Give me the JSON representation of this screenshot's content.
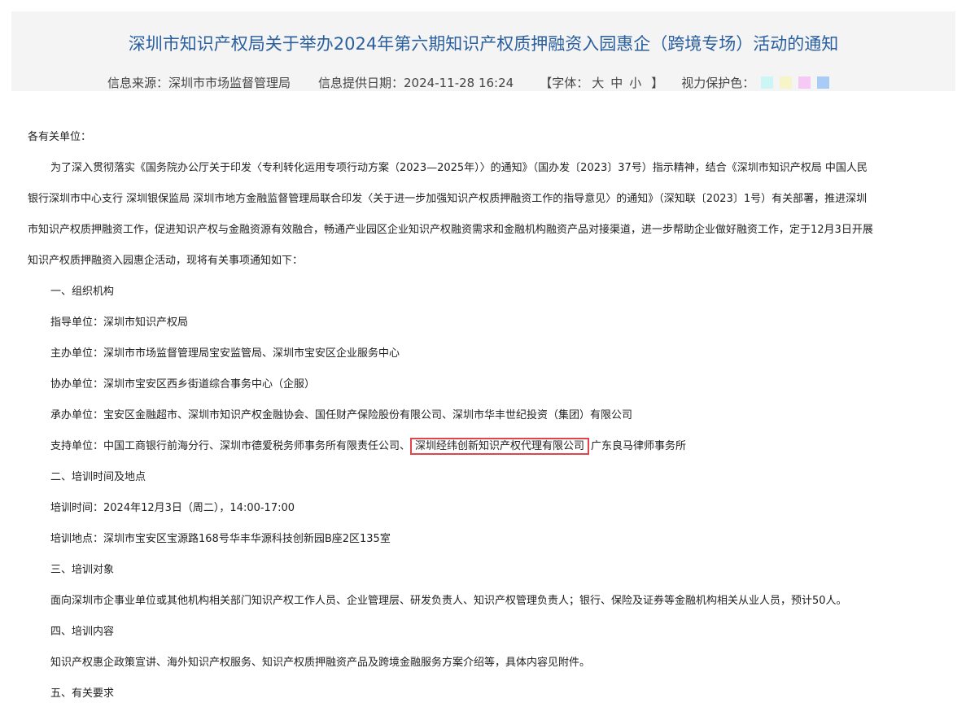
{
  "header": {
    "title": "深圳市知识产权局关于举办2024年第六期知识产权质押融资入园惠企（跨境专场）活动的通知",
    "source": "信息来源：深圳市市场监督管理局",
    "date": "信息提供日期：2024-11-28 16:24",
    "font_open": "【字体：",
    "font_large": "大",
    "font_medium": "中",
    "font_small": "小",
    "font_close": "】",
    "eye_label": "视力保护色：",
    "swatch_colors": [
      "#ccf5f5",
      "#f5f5c8",
      "#f5c8f5",
      "#a8ccf5"
    ]
  },
  "body": {
    "salutation": "各有关单位：",
    "intro_1": "为了深入贯彻落实《国务院办公厅关于印发〈专利转化运用专项行动方案（2023—2025年）〉的通知》（国办发〔2023〕37号）指示精神，结合《深圳市知识产权局 中国人民",
    "intro_2": "银行深圳市中心支行 深圳银保监局 深圳市地方金融监督管理局联合印发〈关于进一步加强知识产权质押融资工作的指导意见〉的通知》（深知联〔2023〕1号）有关部署，推进深圳",
    "intro_3": "市知识产权质押融资工作，促进知识产权与金融资源有效融合，畅通产业园区企业知识产权融资需求和金融机构融资产品对接渠道，进一步帮助企业做好融资工作，定于12月3日开展",
    "intro_4": "知识产权质押融资入园惠企活动，现将有关事项通知如下：",
    "sec1": "一、组织机构",
    "guide": "指导单位：深圳市知识产权局",
    "host": "主办单位：深圳市市场监督管理局宝安监管局、深圳市宝安区企业服务中心",
    "co": "协办单位：深圳市宝安区西乡街道综合事务中心（企服）",
    "organizer": "承办单位：宝安区金融超市、深圳市知识产权金融协会、国任财产保险股份有限公司、深圳市华丰世纪投资（集团）有限公司",
    "support_pre": "支持单位：中国工商银行前海分行、深圳市德爱税务师事务所有限责任公司、",
    "support_hl": "深圳经纬创新知识产权代理有限公司",
    "support_post": "广东良马律师事务所",
    "sec2": "二、培训时间及地点",
    "time": "培训时间：2024年12月3日（周二），14:00-17:00",
    "place": "培训地点：深圳市宝安区宝源路168号华丰华源科技创新园B座2区135室",
    "sec3": "三、培训对象",
    "target": "面向深圳市企事业单位或其他机构相关部门知识产权工作人员、企业管理层、研发负责人、知识产权管理负责人；银行、保险及证券等金融机构相关从业人员，预计50人。",
    "sec4": "四、培训内容",
    "content": "知识产权惠企政策宣讲、海外知识产权服务、知识产权质押融资产品及跨境金融服务方案介绍等，具体内容见附件。",
    "sec5": "五、有关要求"
  }
}
